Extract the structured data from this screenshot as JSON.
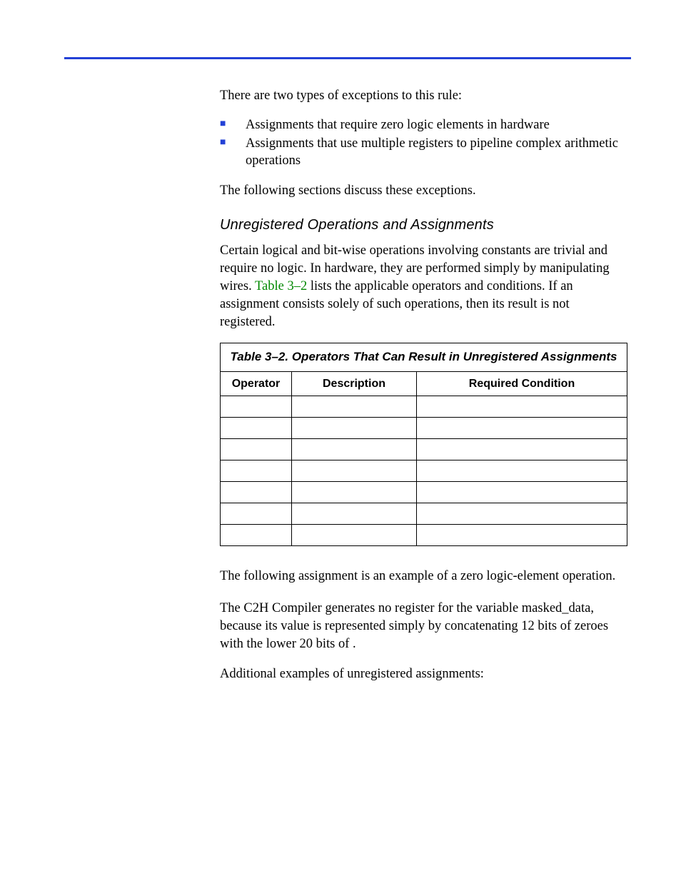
{
  "intro": "There are two types of exceptions to this rule:",
  "bullets": [
    "Assignments that require zero logic elements in hardware",
    "Assignments that use multiple registers to pipeline complex arithmetic operations"
  ],
  "after_bullets": "The following sections discuss these exceptions.",
  "subhead": "Unregistered Operations and Assignments",
  "para1_a": "Certain logical and bit-wise operations involving constants are trivial and require no logic. In hardware, they are performed simply by manipulating wires. ",
  "para1_link": "Table 3–2",
  "para1_b": " lists the applicable operators and conditions. If an assignment consists solely of such operations, then its result is not registered.",
  "table": {
    "title": "Table 3–2. Operators That Can Result in Unregistered Assignments",
    "headers": [
      "Operator",
      "Description",
      "Required Condition"
    ],
    "rows": [
      [
        "",
        "",
        ""
      ],
      [
        "",
        "",
        ""
      ],
      [
        "",
        "",
        ""
      ],
      [
        "",
        "",
        ""
      ],
      [
        "",
        "",
        ""
      ],
      [
        "",
        "",
        ""
      ],
      [
        "",
        "",
        ""
      ]
    ]
  },
  "after_table": "The following assignment is an example of a zero logic-element operation.",
  "code1": "",
  "para2_a": "The C2H Compiler generates no register for the variable masked_data, because its value is represented simply by concatenating 12 bits of zeroes with the lower 20 bits of ",
  "para2_code": "",
  "para2_b": ".",
  "para3": "Additional examples of unregistered assignments:",
  "code2": ""
}
